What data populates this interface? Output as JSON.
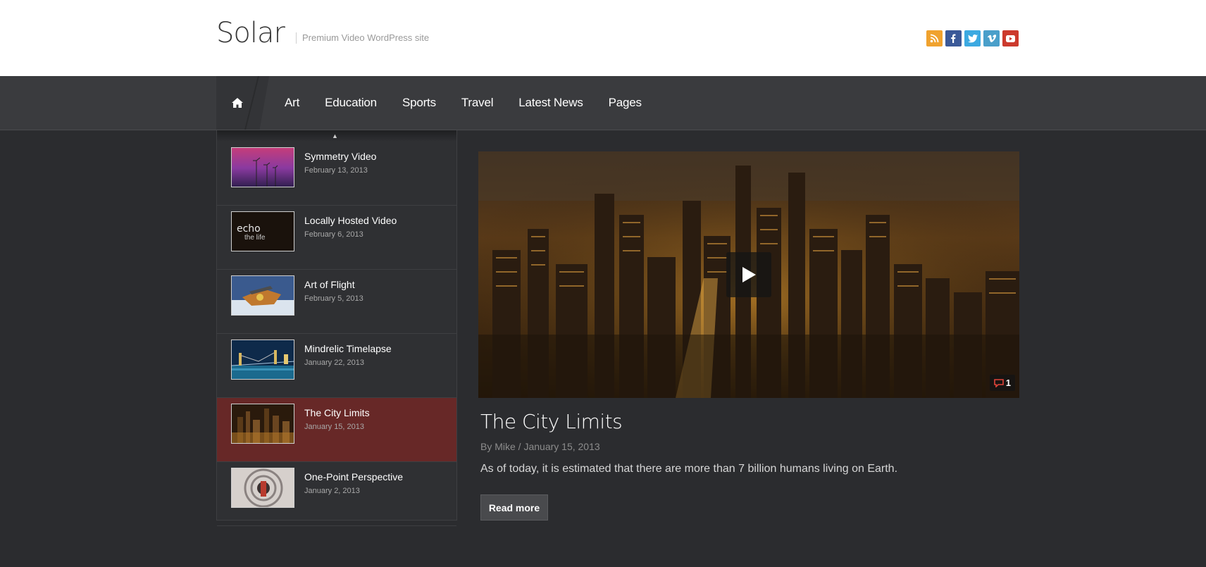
{
  "site": {
    "logo": "Solar",
    "tagline": "Premium Video WordPress site"
  },
  "social": [
    {
      "name": "rss-icon",
      "color": "#f0a22e"
    },
    {
      "name": "facebook-icon",
      "color": "#3b5998"
    },
    {
      "name": "twitter-icon",
      "color": "#3ca9e1"
    },
    {
      "name": "vimeo-icon",
      "color": "#4a9fca"
    },
    {
      "name": "youtube-icon",
      "color": "#cc3a2d"
    }
  ],
  "nav": {
    "items": [
      {
        "label": "Art"
      },
      {
        "label": "Education"
      },
      {
        "label": "Sports"
      },
      {
        "label": "Travel"
      },
      {
        "label": "Latest News"
      },
      {
        "label": "Pages"
      }
    ]
  },
  "sidebar": {
    "items": [
      {
        "title": "Symmetry Video",
        "date": "February 13, 2013"
      },
      {
        "title": "Locally Hosted Video",
        "date": "February 6, 2013",
        "thumb_text": "echo",
        "thumb_text2": "the life"
      },
      {
        "title": "Art of Flight",
        "date": "February 5, 2013"
      },
      {
        "title": "Mindrelic Timelapse",
        "date": "January 22, 2013"
      },
      {
        "title": "The City Limits",
        "date": "January 15, 2013"
      },
      {
        "title": "One-Point Perspective",
        "date": "January 2, 2013"
      }
    ]
  },
  "feature": {
    "title": "The City Limits",
    "meta": "By Mike / January 15, 2013",
    "excerpt": "As of today, it is estimated that there are more than 7 billion humans living on Earth.",
    "comments": "1",
    "read_more": "Read more"
  },
  "colors": {
    "active_item": "#672827",
    "background": "#2b2c2f",
    "nav": "#3a3b3e"
  }
}
